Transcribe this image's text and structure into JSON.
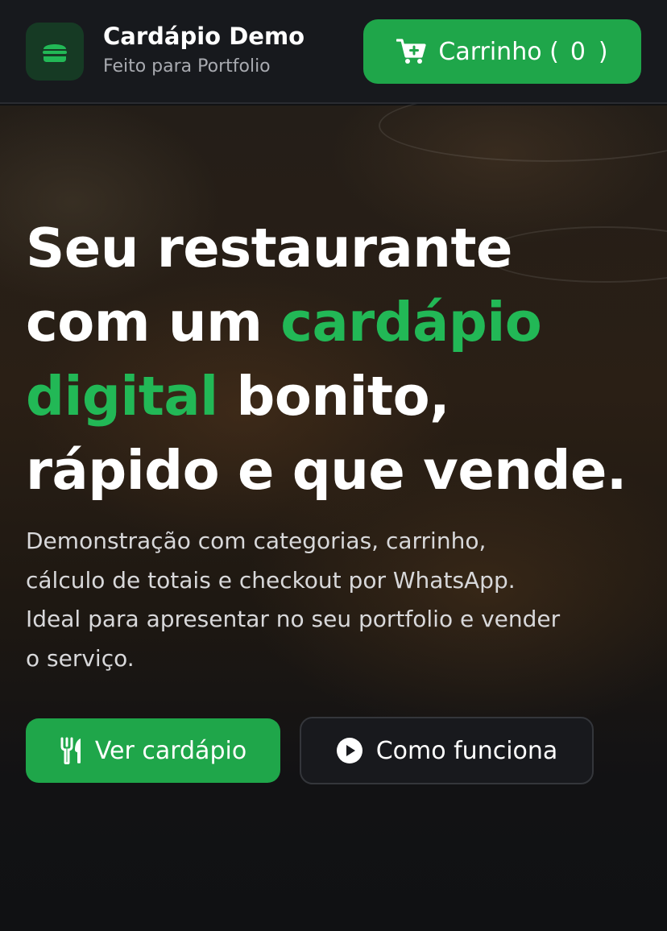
{
  "header": {
    "brand_title": "Cardápio Demo",
    "brand_subtitle": "Feito para Portfolio",
    "logo_icon": "burger-icon",
    "cart": {
      "label": "Carrinho (",
      "count": "0",
      "close": ")",
      "icon": "cart-plus-icon"
    }
  },
  "hero": {
    "headline": {
      "l1": "Seu restaurante",
      "l2_a": "com um ",
      "l2_b": "cardápio",
      "l3_a": "digital",
      "l3_b": " bonito,",
      "l4": "rápido e que vende."
    },
    "description": {
      "l1": "Demonstração com categorias, carrinho,",
      "l2": "cálculo de totais e checkout por WhatsApp.",
      "l3": "Ideal para apresentar no seu portfolio e vender",
      "l4": "o serviço."
    },
    "primary_button": {
      "label": "Ver cardápio",
      "icon": "utensils-icon"
    },
    "secondary_button": {
      "label": "Como funciona",
      "icon": "play-circle-icon"
    }
  },
  "colors": {
    "accent": "#22b856",
    "button_green": "#1fa64a",
    "header_bg": "#17191d"
  }
}
